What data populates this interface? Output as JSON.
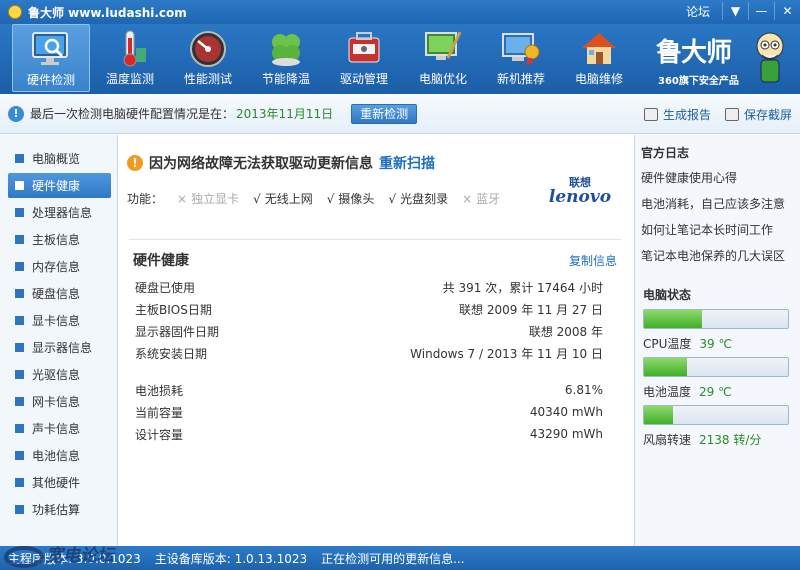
{
  "titlebar": {
    "title": "鲁大师 www.ludashi.com",
    "forum": "论坛"
  },
  "toolbar": {
    "items": [
      {
        "label": "硬件检测",
        "icon": "monitor-magnifier-icon",
        "active": true
      },
      {
        "label": "温度监测",
        "icon": "thermometer-icon"
      },
      {
        "label": "性能测试",
        "icon": "speedometer-icon"
      },
      {
        "label": "节能降温",
        "icon": "clover-icon"
      },
      {
        "label": "驱动管理",
        "icon": "toolbox-icon"
      },
      {
        "label": "电脑优化",
        "icon": "broom-monitor-icon"
      },
      {
        "label": "新机推荐",
        "icon": "award-monitor-icon"
      },
      {
        "label": "电脑维修",
        "icon": "house-icon"
      }
    ],
    "brand_logo": "鲁大师",
    "brand_sub": "360旗下安全产品"
  },
  "infobar": {
    "text": "最后一次检测电脑硬件配置情况是在：",
    "date": "2013年11月11日",
    "recheck": "重新检测",
    "report": "生成报告",
    "screenshot": "保存截屏"
  },
  "sidebar": {
    "items": [
      "电脑概览",
      "硬件健康",
      "处理器信息",
      "主板信息",
      "内存信息",
      "硬盘信息",
      "显卡信息",
      "显示器信息",
      "光驱信息",
      "网卡信息",
      "声卡信息",
      "电池信息",
      "其他硬件",
      "功耗估算"
    ],
    "active_index": 1
  },
  "main": {
    "warning": "因为网络故障无法获取驱动更新信息",
    "rescan": "重新扫描",
    "features_label": "功能：",
    "features": [
      {
        "mark": "×",
        "label": "独立显卡",
        "enabled": false
      },
      {
        "mark": "√",
        "label": "无线上网",
        "enabled": true
      },
      {
        "mark": "√",
        "label": "摄像头",
        "enabled": true
      },
      {
        "mark": "√",
        "label": "光盘刻录",
        "enabled": true
      },
      {
        "mark": "×",
        "label": "蓝牙",
        "enabled": false
      }
    ],
    "brand_cn": "联想",
    "brand_en": "lenovo",
    "section_title": "硬件健康",
    "copy": "复制信息",
    "rows": [
      {
        "label": "硬盘已使用",
        "value": "共 391 次，累计 17464 小时"
      },
      {
        "label": "主板BIOS日期",
        "value": "联想 2009 年 11 月 27 日"
      },
      {
        "label": "显示器固件日期",
        "value": "联想 2008 年"
      },
      {
        "label": "系统安装日期",
        "value": "Windows 7 / 2013 年 11 月 10 日"
      }
    ],
    "battery_rows": [
      {
        "label": "电池损耗",
        "value": "6.81%"
      },
      {
        "label": "当前容量",
        "value": "40340 mWh"
      },
      {
        "label": "设计容量",
        "value": "43290 mWh"
      }
    ]
  },
  "rightpanel": {
    "log_title": "官方日志",
    "links": [
      "硬件健康使用心得",
      "电池消耗，自己应该多注意",
      "如何让笔记本长时间工作",
      "笔记本电池保养的几大误区"
    ],
    "status_title": "电脑状态",
    "stats": [
      {
        "label": "CPU温度",
        "value": "39 ℃",
        "level": 0.4
      },
      {
        "label": "电池温度",
        "value": "29 ℃",
        "level": 0.3
      },
      {
        "label": "风扇转速",
        "value": "2138 转/分",
        "level": 0.2
      }
    ]
  },
  "statusbar": {
    "s1": "主程序版本: 3.0.0.1023",
    "s2": "主设备库版本: 1.0.13.1023",
    "s3": "正在检测可用的更新信息..."
  },
  "watermark": "宽电论坛"
}
